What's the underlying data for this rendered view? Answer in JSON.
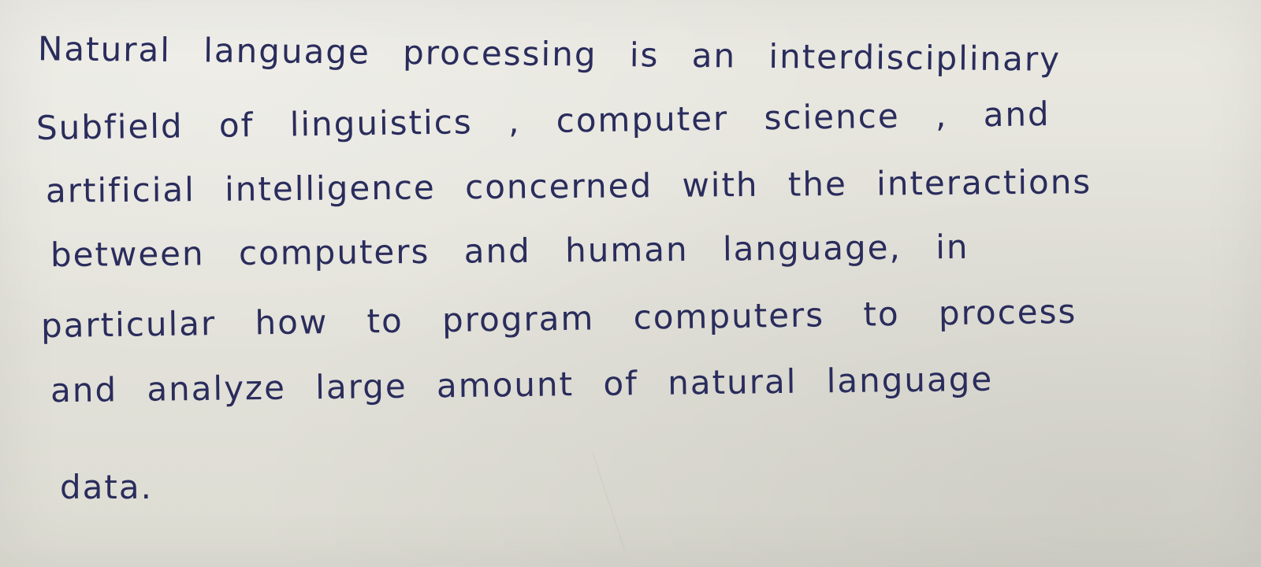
{
  "note": {
    "lines": [
      "Natural language processing is an interdisciplinary",
      "Subfield of linguistics , computer science , and",
      "artificial intelligence concerned with the interactions",
      "between computers and human language, in",
      "particular how to program computers to process",
      "and analyze large amount of natural language",
      "data."
    ]
  },
  "colors": {
    "ink": "#2a2c5c",
    "paper": "#e6e5de"
  }
}
